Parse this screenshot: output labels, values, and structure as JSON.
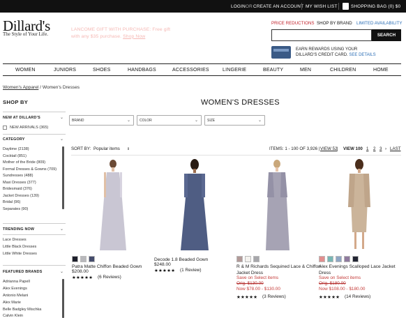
{
  "topbar": {
    "login": "LOGIN",
    "or": "OR",
    "create": "CREATE AN ACCOUNT",
    "wishlist": "MY WISH LIST",
    "bag": "SHOPPING BAG (0) $0"
  },
  "header": {
    "logo": "Dillard's",
    "tagline": "The Style of Your Life.",
    "promo_line1": "LANCOME GIFT WITH PURCHASE: Free gift",
    "promo_line2": "with any $35 purchase.",
    "promo_link": "Shop Now",
    "price_reductions": "PRICE REDUCTIONS",
    "shop_by_brand": "SHOP BY BRAND",
    "limited_availability": "LIMITED AVAILABILITY",
    "search_placeholder": "",
    "search_button": "SEARCH",
    "rewards_line1": "EARN REWARDS USING YOUR",
    "rewards_line2": "DILLARD'S CREDIT CARD.",
    "rewards_link": "SEE DETAILS",
    "colors": {
      "red": "#c2232d",
      "blue": "#2a6db5",
      "promo": "#f5b8b4"
    }
  },
  "nav": [
    "WOMEN",
    "JUNIORS",
    "SHOES",
    "HANDBAGS",
    "ACCESSORIES",
    "LINGERIE",
    "BEAUTY",
    "MEN",
    "CHILDREN",
    "HOME"
  ],
  "breadcrumb": {
    "parent": "Women's Apparel",
    "sep": " / ",
    "current": "Women's Dresses"
  },
  "sidebar": {
    "shop_by": "SHOP BY",
    "new_heading": "NEW AT DILLARD'S",
    "new_arrivals": "NEW ARRIVALS (365)",
    "category_heading": "CATEGORY",
    "categories": [
      "Daytime (2138)",
      "Cocktail (851)",
      "Mother of the Bride (809)",
      "Formal Dresses & Gowns (709)",
      "Sundresses (488)",
      "Maxi Dresses (377)",
      "Bridesmaid (376)",
      "Jacket Dresses (139)",
      "Bridal (96)",
      "Separates (90)"
    ],
    "trending_heading": "TRENDING NOW",
    "trending": [
      "Lace Dresses",
      "Little Black Dresses",
      "Little White Dresses"
    ],
    "featured_heading": "FEATURED BRANDS",
    "brands": [
      "Adrianna Papell",
      "Alex Evenings",
      "Antonio Melani",
      "Alex Marie",
      "Belle Badgley Mischka",
      "Calvin Klein"
    ]
  },
  "main": {
    "title": "WOMEN'S DRESSES",
    "filters": [
      "BRAND",
      "COLOR",
      "SIZE"
    ],
    "sort_label": "SORT BY:",
    "sort_value": "Popular items",
    "items_text": "ITEMS: 1 - 100 OF 3,926 |",
    "view52": "VIEW 52",
    "view_sep": " | ",
    "view100": "VIEW 100",
    "pages": [
      "1",
      "2",
      "3"
    ],
    "last": "LAST",
    "next_icon": "chevron-right-icon"
  },
  "products": [
    {
      "name": "Patra Matte Chiffon Beaded Gown",
      "price": "$208.00",
      "stars": "★★★★★",
      "reviews": "(6 Reviews)",
      "rating": 4.5,
      "swatches": [
        "#1d1f2b",
        "#b8b8bc",
        "#454c6c"
      ],
      "dress_color": "#c9c6d3"
    },
    {
      "name": "Decode 1.8 Beaded Gown",
      "price": "$248.00",
      "stars": "★★★★★",
      "reviews": "(1 Review)",
      "rating": 5,
      "swatches": [],
      "dress_color": "#4f5d83"
    },
    {
      "name_line1": "R & M Richards Sequined Lace & Chiffon",
      "name_line2": "Jacket Dress",
      "sale_select": "Save on Select items",
      "orig": "Orig. $130.00",
      "now": "Now  $78.00 - $130.00",
      "stars": "★★★★★",
      "reviews": "(3 Reviews)",
      "rating": 5,
      "swatches": [
        "#b29a98",
        "#f4f2ee",
        "#a7a7ab"
      ],
      "dress_color": "#a6a3b4"
    },
    {
      "name_line1": "Alex Evenings Scalloped Lace Jacket",
      "name_line2": "Dress",
      "sale_select": "Save on Select items",
      "orig": "Orig. $180.00",
      "now": "Now  $108.00 - $180.00",
      "stars": "★★★★★",
      "reviews": "(14 Reviews)",
      "rating": 4.5,
      "swatches": [
        "#e28e8e",
        "#78b7b5",
        "#8fa6c4",
        "#8f7a9e",
        "#222533"
      ],
      "dress_color": "#cbb49a"
    }
  ]
}
